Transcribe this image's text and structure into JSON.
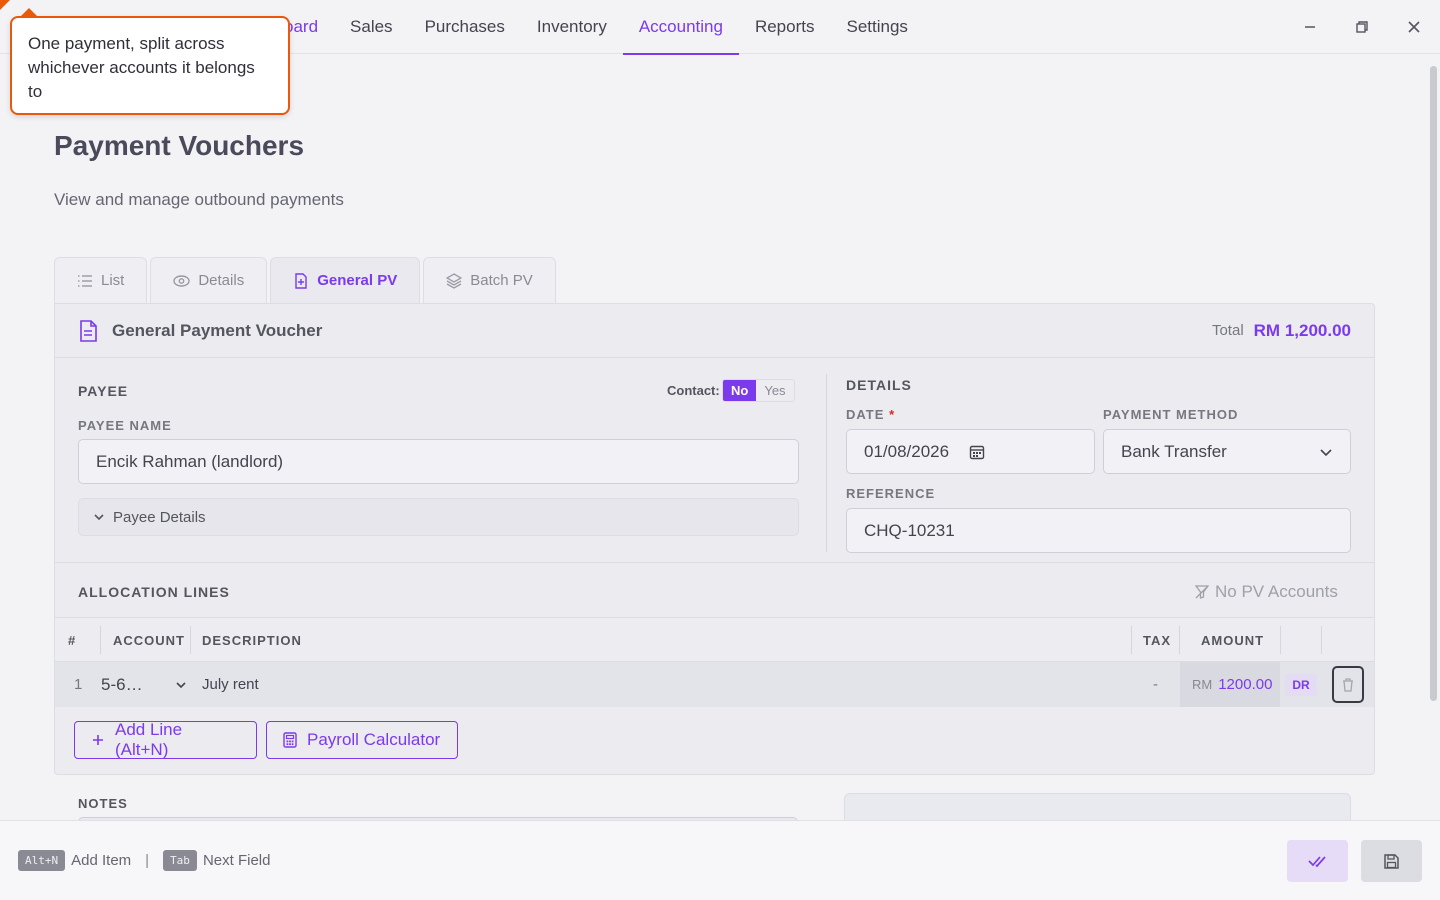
{
  "nav": {
    "tabs": [
      "Dashboard",
      "Sales",
      "Purchases",
      "Inventory",
      "Accounting",
      "Reports",
      "Settings"
    ],
    "visible_first_tab_fragment": "oard",
    "active": "Accounting"
  },
  "tooltip": {
    "text": "One payment, split across whichever accounts it belongs to"
  },
  "page": {
    "title": "Payment Vouchers",
    "subtitle": "View and manage outbound payments"
  },
  "subtabs": [
    {
      "label": "List",
      "icon": "list-icon"
    },
    {
      "label": "Details",
      "icon": "eye-icon"
    },
    {
      "label": "General PV",
      "icon": "document-plus-icon",
      "active": true
    },
    {
      "label": "Batch PV",
      "icon": "layers-icon"
    }
  ],
  "card": {
    "title": "General Payment Voucher",
    "total_label": "Total",
    "total_value": "RM 1,200.00"
  },
  "payee": {
    "section_label": "PAYEE",
    "contact_label": "Contact:",
    "contact_no": "No",
    "contact_yes": "Yes",
    "name_label": "PAYEE NAME",
    "name_value": "Encik Rahman (landlord)",
    "details_toggle": "Payee Details"
  },
  "details": {
    "section_label": "DETAILS",
    "date_label": "DATE",
    "date_required": "*",
    "date_value": "01/08/2026",
    "method_label": "PAYMENT METHOD",
    "method_value": "Bank Transfer",
    "reference_label": "REFERENCE",
    "reference_value": "CHQ-10231"
  },
  "allocation": {
    "section_label": "ALLOCATION LINES",
    "filter_label": "No PV Accounts",
    "columns": {
      "num": "#",
      "account": "ACCOUNT",
      "description": "DESCRIPTION",
      "tax": "TAX",
      "amount": "AMOUNT"
    },
    "rows": [
      {
        "num": "1",
        "account": "5-6…",
        "description": "July rent",
        "tax": "-",
        "currency": "RM",
        "amount": "1200.00",
        "side": "DR"
      }
    ],
    "add_line": "Add Line (Alt+N)",
    "payroll": "Payroll Calculator"
  },
  "notes": {
    "label": "NOTES"
  },
  "footer": {
    "shortcut1_key": "Alt+N",
    "shortcut1_label": "Add Item",
    "separator": "|",
    "shortcut2_key": "Tab",
    "shortcut2_label": "Next Field"
  },
  "colors": {
    "accent": "#7c3aed",
    "tooltip_border": "#ea580c"
  }
}
